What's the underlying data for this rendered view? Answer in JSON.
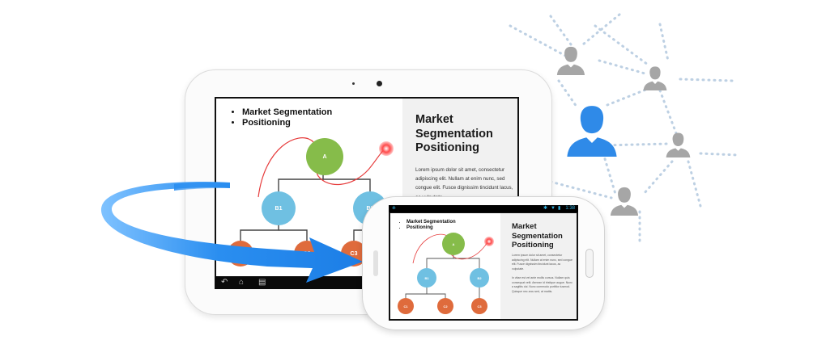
{
  "slide": {
    "bullets": [
      "Market Segmentation",
      "Positioning"
    ],
    "title_lines": [
      "Market",
      "Segmentation",
      "Positioning"
    ],
    "body": "Lorem ipsum dolor sit amet, consectetur adipiscing elit. Nullam at enim nunc, sed congue elit. Fusce dignissim tincidunt lacus, ac vulputate.",
    "body2": "In vitae est vel ante mollis cursus. Nullam quis consequat velit. Aenean id tristique augue. Nunc a sagittis dui. Nunc commodo porttitor iusmod. Quisque nec arcu sed, at mattis.",
    "nodes": {
      "a": "A",
      "b1": "B1",
      "b2": "B2",
      "c1": "C1",
      "c2": "C2",
      "c3": "C3"
    }
  },
  "phone_status": {
    "time": "1:38"
  },
  "colors": {
    "green_node": "#86bc4a",
    "blue_node": "#6fc0e2",
    "orange_node": "#df6b3c",
    "arrow_blue": "#2a8ef0",
    "user_blue": "#2f8ae8",
    "user_gray": "#a6a6a6"
  },
  "icons": {
    "back": "back-icon",
    "home": "home-icon",
    "recents": "recents-icon",
    "main_user": "user-icon",
    "network_user": "user-icon"
  }
}
